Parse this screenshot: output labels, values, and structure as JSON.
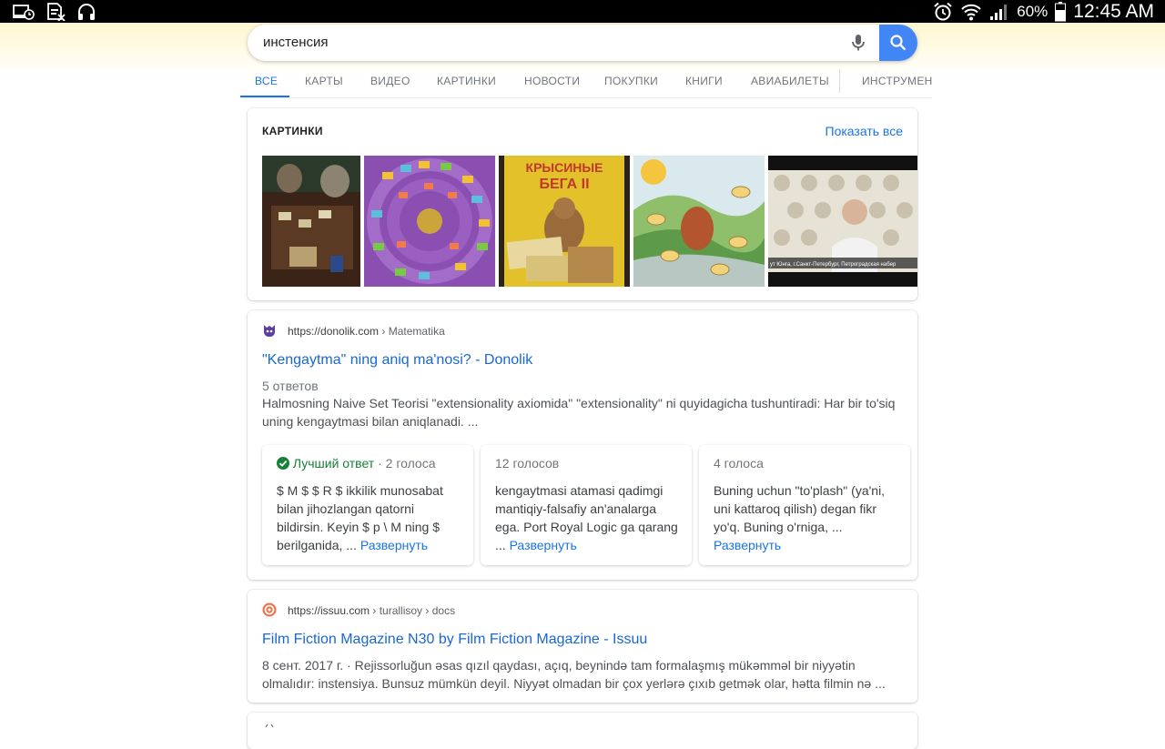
{
  "statusbar": {
    "battery_pct": "60%",
    "time": "12:45 AM"
  },
  "search": {
    "query": "инстенсия"
  },
  "tabs": [
    {
      "label": "ВСЕ",
      "active": true
    },
    {
      "label": "КАРТЫ"
    },
    {
      "label": "ВИДЕО"
    },
    {
      "label": "КАРТИНКИ"
    },
    {
      "label": "НОВОСТИ"
    },
    {
      "label": "ПОКУПКИ"
    },
    {
      "label": "КНИГИ"
    },
    {
      "label": "АВИАБИЛЕТЫ"
    },
    {
      "label": "ИНСТРУМЕН"
    }
  ],
  "images": {
    "title": "КАРТИНКИ",
    "show_all": "Показать все",
    "thumb2_text_line1": "КРЫСИНЫЕ",
    "thumb2_text_line2": "БЕГА II",
    "thumb4_caption": "ут Юнга, г.Санкт-Петербург, Петроградская набер"
  },
  "result1": {
    "url": "https://donolik.com",
    "crumb": " › Matematika",
    "title": "\"Kengaytma\" ning aniq ma'nosi? - Donolik",
    "meta": "5 ответов",
    "snippet": "Halmosning Naive Set Teorisi \"extensionality axiomida\" \"extensionality\" ni quyidagicha tushuntiradi: Har bir to'siq uning kengaytmasi bilan aniqlanadi. ...",
    "answers": [
      {
        "best": "Лучший ответ",
        "votes": " · 2 голоса",
        "text": "$ M $ $ R $ ikkilik munosabat bilan jihozlangan qatorni bildirsin. Keyin $ p \\ M ning $ berilganida, ... ",
        "more": "Развернуть"
      },
      {
        "votes": "12 голосов",
        "text": "kengaytmasi atamasi qadimgi mantiqiy-falsafiy an'analarga ega. Port Royal Logic ga qarang ... ",
        "more": "Развернуть"
      },
      {
        "votes": "4 голоса",
        "text": "Buning uchun \"to'plash\" (ya'ni, uni kattaroq qilish) degan fikr yo'q. Buning o'rniga, ... ",
        "more": "Развернуть"
      }
    ]
  },
  "result2": {
    "url": "https://issuu.com",
    "crumb": " › turallisoy › docs",
    "title": "Film Fiction Magazine N30 by Film Fiction Magazine - Issuu",
    "snippet": "8 сент. 2017 г. · Rejissorluğun əsas qızıl qaydası, açıq, beynində tam formalaşmış mükəmməl bir niyyətin olmalıdır: instensiya. Bunsuz mümkün deyil. Niyyət olmadan bir çox yerlərə çıxıb getmək olar, hətta filmin nə ..."
  }
}
